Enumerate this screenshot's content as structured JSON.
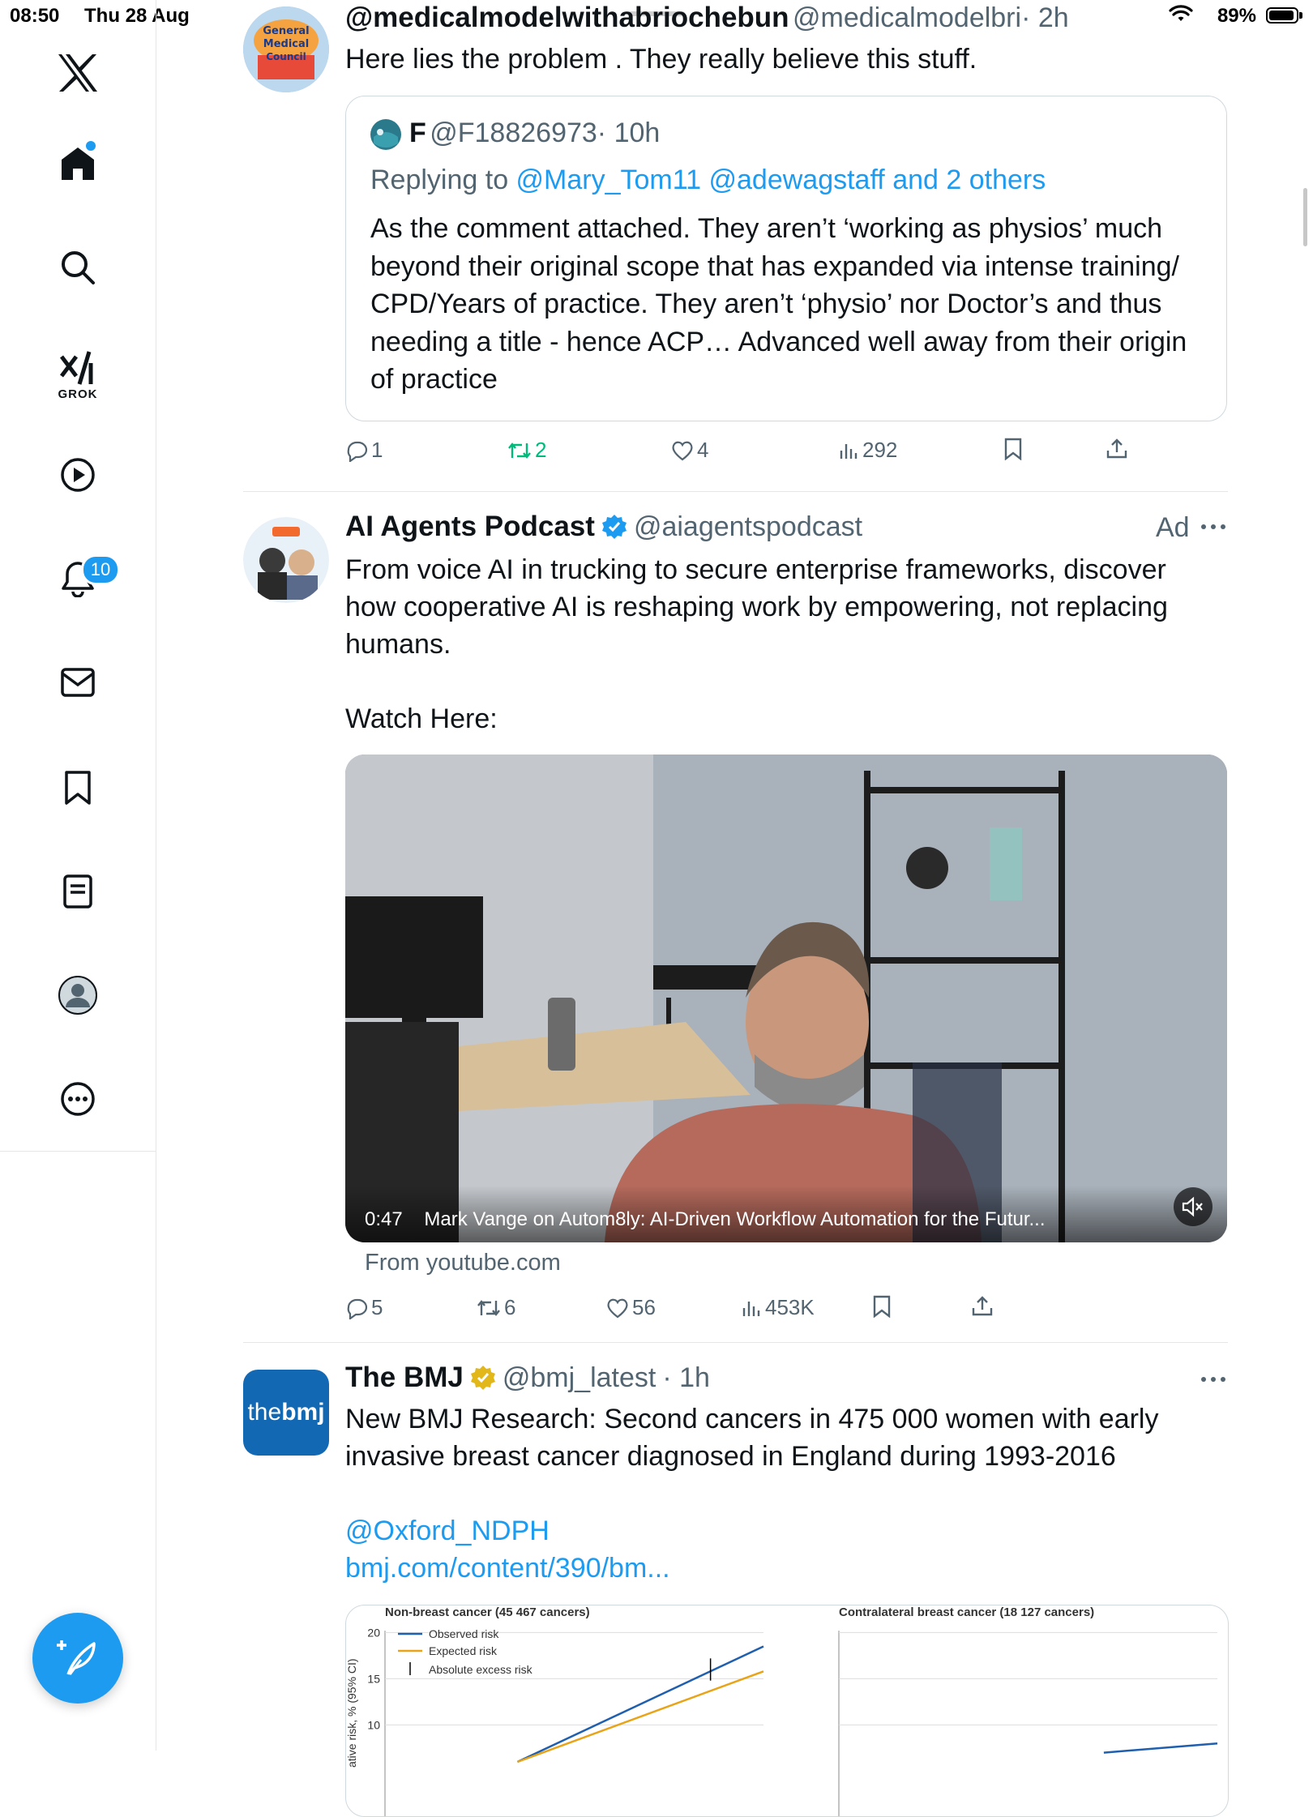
{
  "status_bar": {
    "time": "08:50",
    "date": "Thu 28 Aug",
    "battery": "89%"
  },
  "nav": {
    "grok_label": "GROK",
    "notifications_badge": "10",
    "icons": [
      "x-logo-icon",
      "home-icon",
      "search-icon",
      "grok-icon",
      "video-icon",
      "bell-icon",
      "mail-icon",
      "bookmark-icon",
      "list-icon",
      "profile-icon",
      "more-icon",
      "compose-icon"
    ]
  },
  "tweets": [
    {
      "name": "@medicalmodelwithabriochebun",
      "handle": "@medicalmodelbri",
      "time": "· 2h",
      "text": "Here lies the problem . They really believe this stuff.",
      "quote": {
        "name": "F",
        "handle": "@F18826973",
        "time": "· 10h",
        "replying_prefix": "Replying to ",
        "replying_to": "@Mary_Tom11 @adewagstaff and 2 others",
        "text": "As the comment attached. They aren’t ‘working as physios’ much beyond their original scope that has expanded via intense training/ CPD/Years of practice. They aren’t ‘physio’ nor Doctor’s and thus needing a title - hence ACP… Advanced well away from their origin of practice"
      },
      "replies": "1",
      "reposts": "2",
      "likes": "4",
      "views": "292"
    },
    {
      "name": "AI Agents Podcast",
      "handle": "@aiagentspodcast",
      "ad_label": "Ad",
      "text": "From voice AI in trucking to secure enterprise frameworks, discover how cooperative AI is reshaping work by empowering, not replacing humans.",
      "text2": "Watch Here:",
      "video_duration": "0:47",
      "video_title": "Mark Vange on Autom8ly: AI-Driven Workflow Automation for the Futur...",
      "source": "From youtube.com",
      "replies": "5",
      "reposts": "6",
      "likes": "56",
      "views": "453K"
    },
    {
      "name": "The BMJ",
      "handle": "@bmj_latest",
      "time": "· 1h",
      "logo_text_a": "the",
      "logo_text_b": "bmj",
      "text": "New BMJ Research: Second cancers in 475 000 women with early invasive breast cancer diagnosed in England during 1993-2016",
      "mention": "@Oxford_NDPH",
      "url": "bmj.com/content/390/bm..."
    }
  ],
  "chart_data": [
    {
      "type": "line",
      "title": "Non-breast cancer (45 467 cancers)",
      "ylabel": "ative risk, % (95% CI)",
      "yticks": [
        "20",
        "15",
        "10"
      ],
      "ylim": [
        8,
        21
      ],
      "legend": [
        "Observed risk",
        "Expected risk",
        "Absolute excess risk"
      ],
      "colors": {
        "observed": "#1f5fae",
        "expected": "#e8a317"
      },
      "series": [
        {
          "name": "Observed risk",
          "x": [
            0.35,
            1.0
          ],
          "y": [
            6.0,
            18.5
          ]
        },
        {
          "name": "Expected risk",
          "x": [
            0.35,
            1.0
          ],
          "y": [
            6.0,
            15.8
          ]
        }
      ]
    },
    {
      "type": "line",
      "title": "Contralateral breast cancer (18 127 cancers)",
      "series": [
        {
          "name": "Observed risk",
          "x": [
            0.7,
            1.0
          ],
          "y": [
            7.0,
            8.0
          ]
        }
      ]
    }
  ]
}
